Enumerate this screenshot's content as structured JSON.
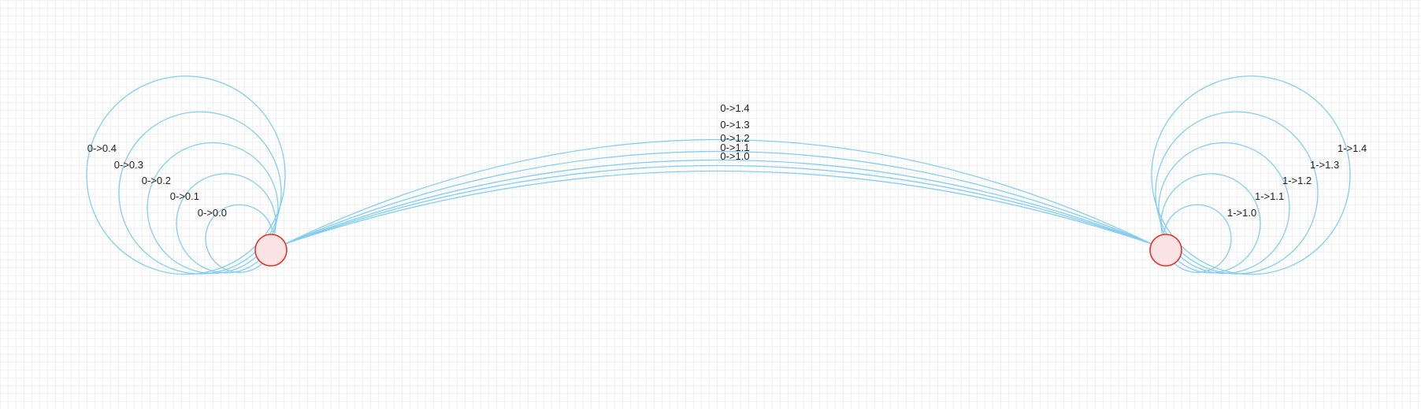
{
  "colors": {
    "edge": "#84cdf0",
    "node_fill": "#fbe3e3",
    "node_stroke": "#e1322e",
    "label": "#222222"
  },
  "nodes": [
    {
      "id": "0"
    },
    {
      "id": "1"
    }
  ],
  "edges": {
    "self_loops_node0": [
      "0->0.0",
      "0->0.1",
      "0->0.2",
      "0->0.3",
      "0->0.4"
    ],
    "node0_to_node1": [
      "0->1.0",
      "0->1.1",
      "0->1.2",
      "0->1.3",
      "0->1.4"
    ],
    "self_loops_node1": [
      "1->1.0",
      "1->1.1",
      "1->1.2",
      "1->1.3",
      "1->1.4"
    ]
  }
}
